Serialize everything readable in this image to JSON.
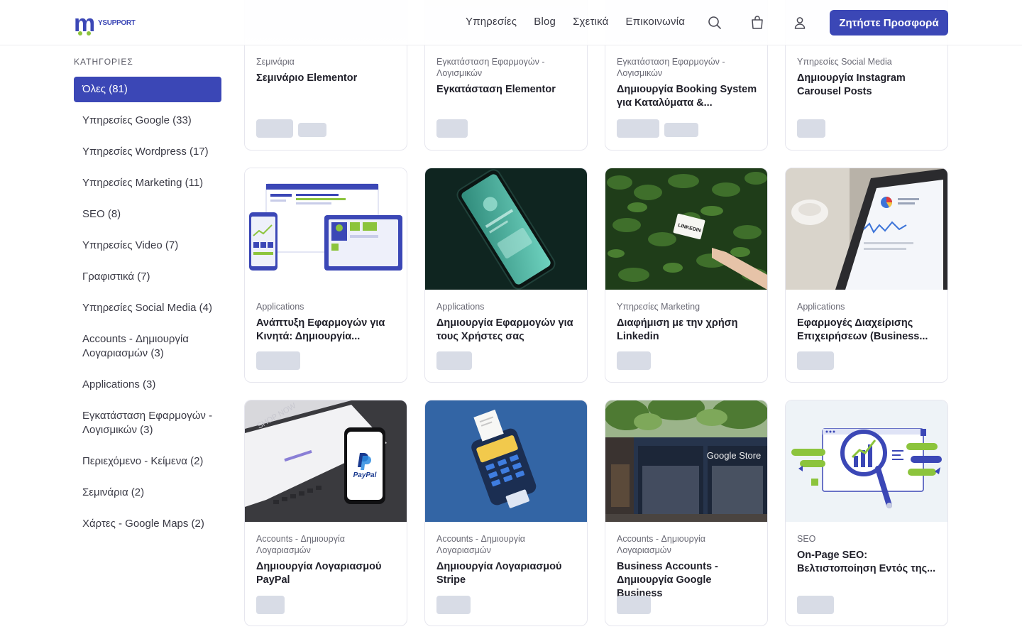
{
  "brand": {
    "logo_text": "YSUPPORT",
    "accent": "#3b47b6",
    "accent2": "#8cc43c"
  },
  "nav": {
    "items": [
      "Υπηρεσίες",
      "Blog",
      "Σχετικά",
      "Επικοινωνία"
    ],
    "cta": "Ζητήστε Προσφορά"
  },
  "sidebar": {
    "title": "ΚΑΤΗΓΟΡΙΕΣ",
    "items": [
      "Όλες (81)",
      "Υπηρεσίες Google (33)",
      "Υπηρεσίες Wordpress (17)",
      "Υπηρεσίες Marketing (11)",
      "SEO (8)",
      "Υπηρεσίες Video (7)",
      "Γραφιστικά (7)",
      "Υπηρεσίες Social Media (4)",
      "Accounts - Δημιουργία Λογαριασμών (3)",
      "Applications (3)",
      "Εγκατάσταση Εφαρμογών - Λογισμικών (3)",
      "Περιεχόμενο - Κείμενα (2)",
      "Σεμινάρια (2)",
      "Χάρτες - Google Maps (2)"
    ]
  },
  "products": [
    {
      "category": "Σεμινάρια",
      "title": "Σεμινάριο Elementor",
      "image": "top-cropped"
    },
    {
      "category": "Εγκατάσταση Εφαρμογών - Λογισμικών",
      "title": "Εγκατάσταση Elementor",
      "image": "top-cropped"
    },
    {
      "category": "Εγκατάσταση Εφαρμογών - Λογισμικών",
      "title": "Δημιουργία Booking System για Καταλύματα &...",
      "image": "top-cropped"
    },
    {
      "category": "Υπηρεσίες Social Media",
      "title": "Δημιουργία Instagram Carousel Posts",
      "image": "top-cropped"
    },
    {
      "category": "Applications",
      "title": "Ανάπτυξη Εφαρμογών για Κινητά: Δημιουργία...",
      "image": "devices-illustration"
    },
    {
      "category": "Applications",
      "title": "Δημιουργία Εφαρμογών για τους Χρήστες σας",
      "image": "phone-on-dark"
    },
    {
      "category": "Υπηρεσίες Marketing",
      "title": "Διαφήμιση με την χρήση Linkedin",
      "image": "linkedin-card-leaves",
      "image_text": "LINKEDIN"
    },
    {
      "category": "Applications",
      "title": "Εφαρμογές Διαχείρισης Επιχειρήσεων (Business...",
      "image": "tablet-dashboard"
    },
    {
      "category": "Accounts - Δημιουργία Λογαριασμών",
      "title": "Δημιουργία Λογαριασμού PayPal",
      "image": "paypal-phone",
      "image_text": "PayPal",
      "image_text2": "SHOP NOW"
    },
    {
      "category": "Accounts - Δημιουργία Λογαριασμών",
      "title": "Δημιουργία Λογαριασμού Stripe",
      "image": "card-terminal"
    },
    {
      "category": "Accounts - Δημιουργία Λογαριασμών",
      "title": "Business Accounts - Δημιουργία Google Business",
      "image": "google-store",
      "image_text": "Google Store"
    },
    {
      "category": "SEO",
      "title": "On-Page SEO: Βελτιστοποίηση Εντός της...",
      "image": "seo-illustration"
    }
  ]
}
